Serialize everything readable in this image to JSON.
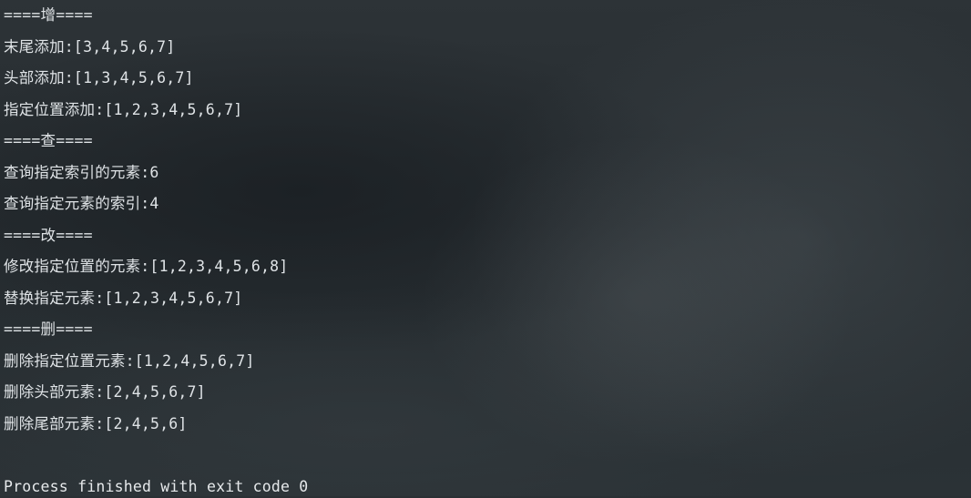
{
  "console": {
    "lines": [
      "====增====",
      "末尾添加:[3,4,5,6,7]",
      "头部添加:[1,3,4,5,6,7]",
      "指定位置添加:[1,2,3,4,5,6,7]",
      "====查====",
      "查询指定索引的元素:6",
      "查询指定元素的索引:4",
      "====改====",
      "修改指定位置的元素:[1,2,3,4,5,6,8]",
      "替换指定元素:[1,2,3,4,5,6,7]",
      "====删====",
      "删除指定位置元素:[1,2,4,5,6,7]",
      "删除头部元素:[2,4,5,6,7]",
      "删除尾部元素:[2,4,5,6]"
    ],
    "exit_message": "Process finished with exit code 0"
  }
}
